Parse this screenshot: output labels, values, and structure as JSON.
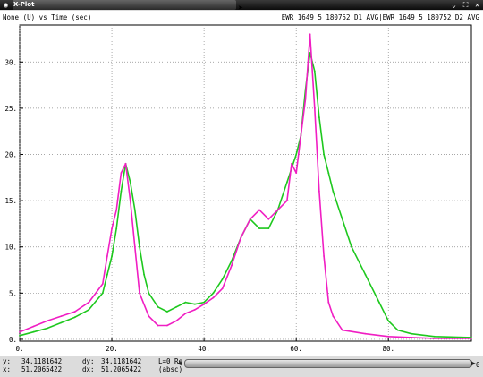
{
  "window": {
    "title": "X-Plot"
  },
  "header": {
    "title_left": "None (U) vs Time (sec)",
    "title_right": "EWR_1649_5_180752_D1_AVG|EWR_1649_5_180752_D2_AVG"
  },
  "status": {
    "y_label": "y:",
    "y_value": "34.1181642",
    "x_label": "x:",
    "x_value": "51.2065422",
    "dy_label": "dy:",
    "dy_value": "34.1181642",
    "dx_label": "dx:",
    "dx_value": "51.2065422",
    "mode": "L=0 Re",
    "mode2": "(absc)",
    "corner": "0"
  },
  "colors": {
    "d1": "#f01ec3",
    "d2": "#1ec81e",
    "grid": "#8a8a8a"
  },
  "chart_data": {
    "type": "line",
    "title": "None (U) vs Time (sec)",
    "xlim": [
      0,
      98
    ],
    "ylim": [
      -0.2,
      34
    ],
    "grid": true,
    "x_ticks": [
      0,
      20,
      40,
      60,
      80
    ],
    "x_tick_labels": [
      "0.",
      "20.",
      "40.",
      "60.",
      "80."
    ],
    "y_ticks": [
      0,
      5,
      10,
      15,
      20,
      25,
      30
    ],
    "y_tick_labels": [
      "0.",
      "5.",
      "10.",
      "15.",
      "20.",
      "25.",
      "30."
    ],
    "series": [
      {
        "name": "EWR_1649_5_180752_D1_AVG",
        "color": "#f01ec3",
        "x": [
          0,
          3,
          6,
          9,
          12,
          15,
          18,
          19,
          20,
          21,
          22,
          23,
          24,
          25,
          26,
          28,
          30,
          32,
          34,
          36,
          38,
          40,
          42,
          44,
          46,
          48,
          50,
          52,
          54,
          56,
          58,
          59,
          60,
          61,
          62,
          63,
          64,
          65,
          66,
          67,
          68,
          70,
          75,
          80,
          85,
          90,
          98
        ],
        "y": [
          0.8,
          1.4,
          2,
          2.5,
          3,
          4,
          6,
          9,
          12,
          14,
          18,
          19,
          15,
          10,
          5,
          2.5,
          1.5,
          1.5,
          2,
          2.8,
          3.2,
          3.8,
          4.5,
          5.5,
          8,
          11,
          13,
          14,
          13,
          14,
          15,
          19,
          18,
          22,
          26,
          33,
          25,
          16,
          9,
          4,
          2.5,
          1,
          0.6,
          0.3,
          0.2,
          0.1,
          0.1
        ]
      },
      {
        "name": "EWR_1649_5_180752_D2_AVG",
        "color": "#1ec81e",
        "x": [
          0,
          3,
          6,
          9,
          12,
          15,
          18,
          19,
          20,
          21,
          22,
          23,
          24,
          25,
          26,
          27,
          28,
          30,
          32,
          34,
          36,
          38,
          40,
          42,
          44,
          46,
          48,
          50,
          52,
          54,
          56,
          58,
          60,
          61,
          62,
          63,
          64,
          65,
          66,
          67,
          68,
          70,
          72,
          75,
          78,
          80,
          82,
          85,
          90,
          98
        ],
        "y": [
          0.4,
          0.8,
          1.2,
          1.8,
          2.4,
          3.2,
          5,
          7,
          9,
          12,
          16,
          19,
          17,
          14,
          10,
          7,
          5,
          3.5,
          3,
          3.5,
          4,
          3.8,
          4,
          5,
          6.5,
          8.5,
          11,
          13,
          12,
          12,
          14,
          17,
          20,
          22,
          27,
          31,
          29,
          24,
          20,
          18,
          16,
          13,
          10,
          7,
          4,
          2,
          1,
          0.6,
          0.3,
          0.2
        ]
      }
    ]
  }
}
